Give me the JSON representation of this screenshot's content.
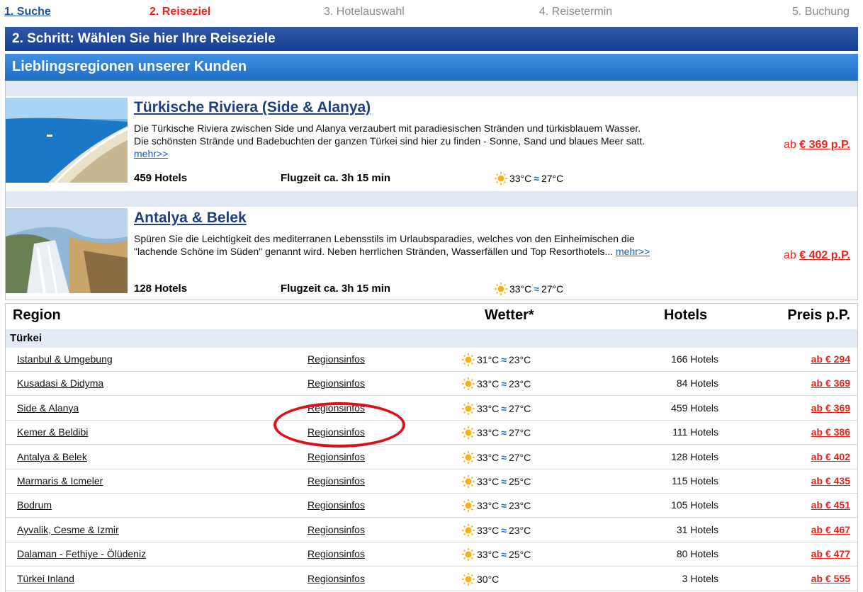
{
  "steps": [
    {
      "label": "1. Suche"
    },
    {
      "label": "2. Reiseziel"
    },
    {
      "label": "3. Hotelauswahl"
    },
    {
      "label": "4. Reisetermin"
    },
    {
      "label": "5. Buchung"
    }
  ],
  "header": {
    "title": "2. Schritt: Wählen Sie hier Ihre Reiseziele",
    "subtitle": "Lieblingsregionen unserer Kunden"
  },
  "featured": [
    {
      "title": "Türkische Riviera (Side & Alanya)",
      "description": "Die Türkische Riviera zwischen Side und Alanya verzaubert mit paradiesischen Stränden und türkisblauem Wasser. Die schönsten Strände und Badebuchten der ganzen Türkei sind hier zu finden - Sonne, Sand und blaues Meer satt.",
      "more": "mehr>>",
      "hotels": "459 Hotels",
      "flight": "Flugzeit ca. 3h 15 min",
      "air_temp": "33°C",
      "water_temp": "27°C",
      "price_prefix": "ab",
      "price": "€ 369 p.P.",
      "image_icon": "beach-coast-photo"
    },
    {
      "title": "Antalya & Belek",
      "description": "Spüren Sie die Leichtigkeit des mediterranen Lebensstils im Urlaubsparadies, welches von den Einheimischen die \"lachende Schöne im Süden\" genannt wird. Neben herrlichen Stränden, Wasserfällen und Top Resorthotels...",
      "more": "mehr>>",
      "hotels": "128 Hotels",
      "flight": "Flugzeit ca. 3h 15 min",
      "air_temp": "33°C",
      "water_temp": "27°C",
      "price_prefix": "ab",
      "price": "€ 402 p.P.",
      "image_icon": "waterfall-photo"
    }
  ],
  "table": {
    "headers": {
      "region": "Region",
      "weather": "Wetter*",
      "hotels": "Hotels",
      "price": "Preis p.P."
    },
    "country": "Türkei",
    "rows": [
      {
        "name": "Istanbul & Umgebung",
        "info": "Regionsinfos",
        "air": "31°C",
        "water": "23°C",
        "hotels": "166 Hotels",
        "price": "ab € 294"
      },
      {
        "name": "Kusadasi & Didyma",
        "info": "Regionsinfos",
        "air": "33°C",
        "water": "23°C",
        "hotels": "84 Hotels",
        "price": "ab € 369"
      },
      {
        "name": "Side & Alanya",
        "info": "Regionsinfos",
        "air": "33°C",
        "water": "27°C",
        "hotels": "459 Hotels",
        "price": "ab € 369"
      },
      {
        "name": "Kemer & Beldibi",
        "info": "Regionsinfos",
        "air": "33°C",
        "water": "27°C",
        "hotels": "111 Hotels",
        "price": "ab € 386"
      },
      {
        "name": "Antalya & Belek",
        "info": "Regionsinfos",
        "air": "33°C",
        "water": "27°C",
        "hotels": "128 Hotels",
        "price": "ab € 402"
      },
      {
        "name": "Marmaris & Icmeler",
        "info": "Regionsinfos",
        "air": "33°C",
        "water": "25°C",
        "hotels": "115 Hotels",
        "price": "ab € 435"
      },
      {
        "name": "Bodrum",
        "info": "Regionsinfos",
        "air": "33°C",
        "water": "23°C",
        "hotels": "105 Hotels",
        "price": "ab € 451"
      },
      {
        "name": "Ayvalik, Cesme & Izmir",
        "info": "Regionsinfos",
        "air": "33°C",
        "water": "23°C",
        "hotels": "31 Hotels",
        "price": "ab € 467"
      },
      {
        "name": "Dalaman - Fethiye - Ölüdeniz",
        "info": "Regionsinfos",
        "air": "33°C",
        "water": "25°C",
        "hotels": "80 Hotels",
        "price": "ab € 477"
      },
      {
        "name": "Türkei Inland",
        "info": "Regionsinfos",
        "air": "30°C",
        "water": "",
        "hotels": "3 Hotels",
        "price": "ab € 555"
      }
    ]
  },
  "colors": {
    "accent_red": "#e8231b",
    "header_blue": "#173f8f",
    "sub_blue": "#1f6fc8",
    "highlight_circle": "#e0101a"
  },
  "icons": {
    "weather_air": "sun-icon",
    "weather_water": "wave-icon"
  }
}
